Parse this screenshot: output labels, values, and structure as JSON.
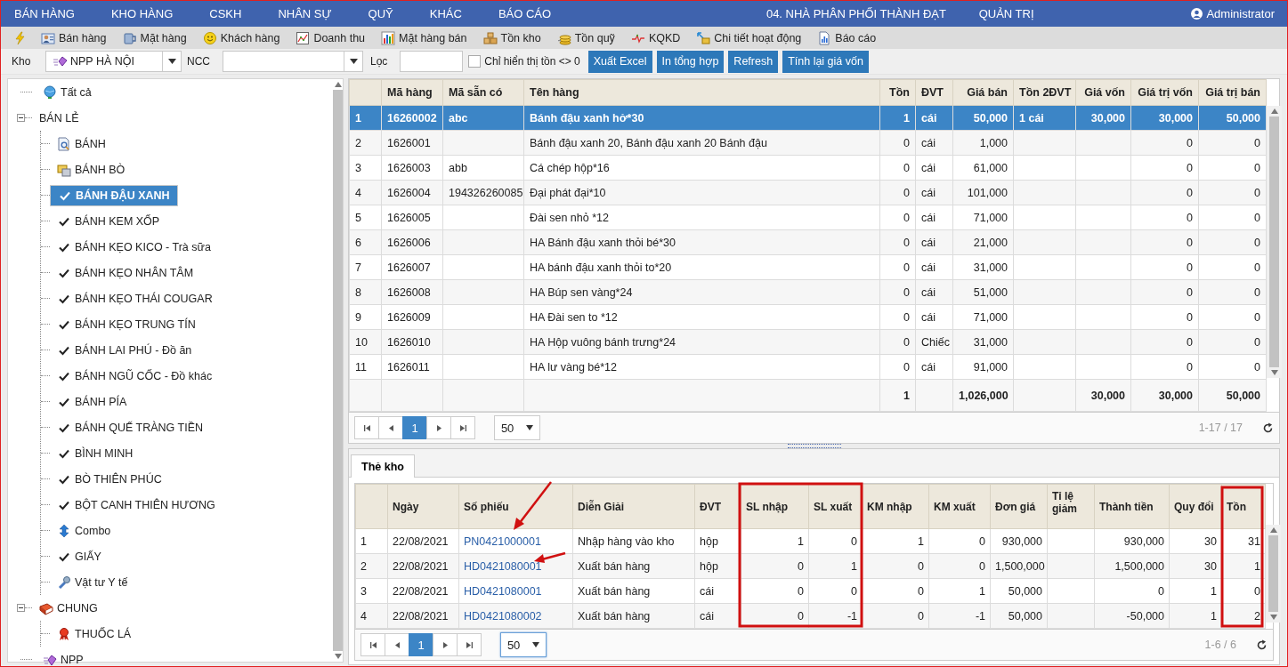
{
  "top_nav": {
    "menus": [
      "BÁN HÀNG",
      "KHO HÀNG",
      "CSKH",
      "NHÂN SỰ",
      "QUỸ",
      "KHÁC",
      "BÁO CÁO"
    ],
    "company": "04. NHÀ PHÂN PHỐI THÀNH ĐẠT",
    "admin_menu": "QUẢN TRỊ",
    "user": "Administrator"
  },
  "toolbar": [
    {
      "kind": "bolt"
    },
    {
      "kind": "person",
      "label": "Bán hàng"
    },
    {
      "kind": "mug",
      "label": "Mặt hàng"
    },
    {
      "kind": "smiley",
      "label": "Khách hàng"
    },
    {
      "kind": "linechart",
      "label": "Doanh thu"
    },
    {
      "kind": "barchart",
      "label": "Mặt hàng bán"
    },
    {
      "kind": "boxes",
      "label": "Tồn kho"
    },
    {
      "kind": "coins",
      "label": "Tồn quỹ"
    },
    {
      "kind": "pulse",
      "label": "KQKD"
    },
    {
      "kind": "arrows",
      "label": "Chi tiết hoạt động"
    },
    {
      "kind": "report",
      "label": "Báo cáo"
    }
  ],
  "filters": {
    "kho_label": "Kho",
    "kho_value": "NPP HÀ NỘI",
    "ncc_label": "NCC",
    "loc_label": "Lọc",
    "only_stock": {
      "label": "Chỉ hiển thị tồn <> 0",
      "checked": false
    },
    "buttons": [
      "Xuất Excel",
      "In tổng hợp",
      "Refresh",
      "Tính lại giá vốn"
    ]
  },
  "tree": [
    {
      "label": "Tất cả",
      "kind": "globe",
      "selected": false
    },
    {
      "label": "BÁN LẺ",
      "kind": "plain",
      "selected": false,
      "expanded": true,
      "children": [
        {
          "label": "BÁNH",
          "kind": "doc",
          "selected": false
        },
        {
          "label": "BÁNH BÒ",
          "kind": "folders",
          "selected": false
        },
        {
          "label": "BÁNH ĐẬU XANH",
          "kind": "check",
          "selected": true
        },
        {
          "label": "BÁNH KEM XỐP",
          "kind": "check",
          "selected": false
        },
        {
          "label": "BÁNH KẸO KICO - Trà sữa",
          "kind": "check",
          "selected": false
        },
        {
          "label": "BÁNH KẸO NHÂN TÂM",
          "kind": "check",
          "selected": false
        },
        {
          "label": "BÁNH KẸO THÁI COUGAR",
          "kind": "check",
          "selected": false
        },
        {
          "label": "BÁNH KẸO TRUNG TÍN",
          "kind": "check",
          "selected": false
        },
        {
          "label": "BÁNH LAI PHÚ - Đồ ăn",
          "kind": "check",
          "selected": false
        },
        {
          "label": "BÁNH NGŨ CỐC - Đồ khác",
          "kind": "check",
          "selected": false
        },
        {
          "label": "BÁNH PÍA",
          "kind": "check",
          "selected": false
        },
        {
          "label": "BÁNH QUẾ TRÀNG TIỀN",
          "kind": "check",
          "selected": false
        },
        {
          "label": "BÌNH MINH",
          "kind": "check",
          "selected": false
        },
        {
          "label": "BÒ THIÊN PHÚC",
          "kind": "check",
          "selected": false
        },
        {
          "label": "BỘT CANH THIÊN HƯƠNG",
          "kind": "check",
          "selected": false
        },
        {
          "label": "Combo",
          "kind": "updown",
          "selected": false
        },
        {
          "label": "GIẤY",
          "kind": "check",
          "selected": false
        },
        {
          "label": "Vật tư Y tế",
          "kind": "tool",
          "selected": false
        }
      ]
    },
    {
      "label": "CHUNG",
      "kind": "book",
      "selected": false,
      "expanded": true,
      "children": [
        {
          "label": "THUỐC LÁ",
          "kind": "ribbon",
          "selected": false
        }
      ]
    },
    {
      "label": "NPP",
      "kind": "gem",
      "selected": false
    }
  ],
  "products": {
    "columns": [
      "Mã hàng",
      "Mã sẵn có",
      "Tên hàng",
      "Tồn",
      "ĐVT",
      "Giá bán",
      "Tồn 2ĐVT",
      "Giá vốn",
      "Giá trị vốn",
      "Giá trị bán"
    ],
    "rows": [
      {
        "selected": true,
        "stt": "1",
        "ma_hang": "16260002",
        "ma_san_co": "abc",
        "ten_hang": "Bánh đậu xanh hở*30",
        "ton": "1",
        "dvt": "cái",
        "gia_ban": "50,000",
        "ton_2dvt": "1 cái",
        "gia_von": "30,000",
        "gia_tri_von": "30,000",
        "gia_tri_ban": "50,000"
      },
      {
        "selected": false,
        "stt": "2",
        "ma_hang": "1626001",
        "ten_hang": "Bánh đậu xanh 20, Bánh đậu xanh 20 Bánh đậu",
        "ton": "0",
        "dvt": "cái",
        "gia_ban": "1,000",
        "gia_tri_von": "0",
        "gia_tri_ban": "0"
      },
      {
        "selected": false,
        "stt": "3",
        "ma_hang": "1626003",
        "ma_san_co": "abb",
        "ten_hang": "Cá chép hộp*16",
        "ton": "0",
        "dvt": "cái",
        "gia_ban": "61,000",
        "gia_tri_von": "0",
        "gia_tri_ban": "0"
      },
      {
        "selected": false,
        "stt": "4",
        "ma_hang": "1626004",
        "ma_san_co": "194326260085",
        "ten_hang": "Đại phát đại*10",
        "ton": "0",
        "dvt": "cái",
        "gia_ban": "101,000",
        "gia_tri_von": "0",
        "gia_tri_ban": "0"
      },
      {
        "selected": false,
        "stt": "5",
        "ma_hang": "1626005",
        "ten_hang": "Đài sen nhỏ *12",
        "ton": "0",
        "dvt": "cái",
        "gia_ban": "71,000",
        "gia_tri_von": "0",
        "gia_tri_ban": "0"
      },
      {
        "selected": false,
        "stt": "6",
        "ma_hang": "1626006",
        "ten_hang": "HA Bánh đậu xanh thỏi bé*30",
        "ton": "0",
        "dvt": "cái",
        "gia_ban": "21,000",
        "gia_tri_von": "0",
        "gia_tri_ban": "0"
      },
      {
        "selected": false,
        "stt": "7",
        "ma_hang": "1626007",
        "ten_hang": "HA bánh đậu xanh thỏi to*20",
        "ton": "0",
        "dvt": "cái",
        "gia_ban": "31,000",
        "gia_tri_von": "0",
        "gia_tri_ban": "0"
      },
      {
        "selected": false,
        "stt": "8",
        "ma_hang": "1626008",
        "ten_hang": "HA Búp sen vàng*24",
        "ton": "0",
        "dvt": "cái",
        "gia_ban": "51,000",
        "gia_tri_von": "0",
        "gia_tri_ban": "0"
      },
      {
        "selected": false,
        "stt": "9",
        "ma_hang": "1626009",
        "ten_hang": "HA Đài sen to *12",
        "ton": "0",
        "dvt": "cái",
        "gia_ban": "71,000",
        "gia_tri_von": "0",
        "gia_tri_ban": "0"
      },
      {
        "selected": false,
        "stt": "10",
        "ma_hang": "1626010",
        "ten_hang": "HA Hộp vuông bánh trưng*24",
        "ton": "0",
        "dvt": "Chiếc",
        "gia_ban": "31,000",
        "gia_tri_von": "0",
        "gia_tri_ban": "0"
      },
      {
        "selected": false,
        "stt": "11",
        "ma_hang": "1626011",
        "ten_hang": "HA lư vàng bé*12",
        "ton": "0",
        "dvt": "cái",
        "gia_ban": "91,000",
        "gia_tri_von": "0",
        "gia_tri_ban": "0"
      }
    ],
    "totals": {
      "ton": "1",
      "gia_ban": "1,026,000",
      "gia_von": "30,000",
      "gia_tri_von": "30,000",
      "gia_tri_ban": "50,000"
    },
    "pager": {
      "pages": [
        {
          "label": "1",
          "selected": true
        }
      ],
      "page_size": "50",
      "summary": "1-17 / 17"
    }
  },
  "tabs": [
    {
      "label": "Thẻ kho",
      "selected": true
    }
  ],
  "stock_card": {
    "columns": [
      "Ngày",
      "Số phiếu",
      "Diễn Giải",
      "ĐVT",
      "SL nhập",
      "SL xuất",
      "KM nhập",
      "KM xuất",
      "Đơn giá",
      "Tỉ lệ giảm",
      "Thành tiền",
      "Quy đổi",
      "Tồn"
    ],
    "rows": [
      {
        "stt": "1",
        "ngay": "22/08/2021",
        "so_phieu": "PN0421000001",
        "dien_giai": "Nhập hàng vào kho",
        "dvt": "hộp",
        "sl_nhap": "1",
        "sl_xuat": "0",
        "km_nhap": "1",
        "km_xuat": "0",
        "don_gia": "930,000",
        "thanh_tien": "930,000",
        "quy_doi": "30",
        "ton": "31"
      },
      {
        "stt": "2",
        "ngay": "22/08/2021",
        "so_phieu": "HD0421080001",
        "dien_giai": "Xuất bán hàng",
        "dvt": "hộp",
        "sl_nhap": "0",
        "sl_xuat": "1",
        "km_nhap": "0",
        "km_xuat": "0",
        "don_gia": "1,500,000",
        "thanh_tien": "1,500,000",
        "quy_doi": "30",
        "ton": "1"
      },
      {
        "stt": "3",
        "ngay": "22/08/2021",
        "so_phieu": "HD0421080001",
        "dien_giai": "Xuất bán hàng",
        "dvt": "cái",
        "sl_nhap": "0",
        "sl_xuat": "0",
        "km_nhap": "0",
        "km_xuat": "1",
        "don_gia": "50,000",
        "thanh_tien": "0",
        "quy_doi": "1",
        "ton": "0"
      },
      {
        "stt": "4",
        "ngay": "22/08/2021",
        "so_phieu": "HD0421080002",
        "dien_giai": "Xuất bán hàng",
        "dvt": "cái",
        "sl_nhap": "0",
        "sl_xuat": "-1",
        "km_nhap": "0",
        "km_xuat": "-1",
        "don_gia": "50,000",
        "thanh_tien": "-50,000",
        "quy_doi": "1",
        "ton": "2"
      }
    ],
    "pager": {
      "pages": [
        {
          "label": "1",
          "selected": true
        }
      ],
      "page_size": "50",
      "summary": "1-6 / 6"
    }
  }
}
